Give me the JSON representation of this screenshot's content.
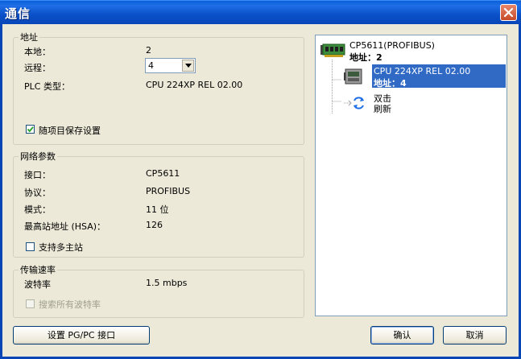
{
  "window": {
    "title": "通信"
  },
  "address": {
    "legend": "地址",
    "local_label": "本地：",
    "local_value": "2",
    "remote_label": "远程：",
    "remote_value": "4",
    "plc_type_label": "PLC 类型：",
    "plc_type_value": "CPU 224XP REL 02.00",
    "save_with_project_label": "随项目保存设置",
    "save_with_project_checked": true
  },
  "network": {
    "legend": "网络参数",
    "interface_label": "接口：",
    "interface_value": "CP5611",
    "protocol_label": "协议：",
    "protocol_value": "PROFIBUS",
    "mode_label": "模式：",
    "mode_value": "11 位",
    "hsa_label": "最高站地址 (HSA)：",
    "hsa_value": "126",
    "multimaster_label": "支持多主站",
    "multimaster_checked": false
  },
  "baud": {
    "legend": "传输速率",
    "rate_label": "波特率",
    "rate_value": "1.5 mbps",
    "search_all_label": "搜索所有波特率",
    "search_all_checked": false
  },
  "tree": {
    "root_name": "CP5611(PROFIBUS)",
    "root_addr": "地址：2",
    "device_name": "CPU 224XP REL 02.00",
    "device_addr": "地址：4",
    "refresh_line1": "双击",
    "refresh_line2": "刷新"
  },
  "buttons": {
    "set_pgpc": "设置 PG/PC 接口",
    "ok": "确认",
    "cancel": "取消"
  },
  "colors": {
    "title_bar": "#0a50c8",
    "selection": "#316ac5",
    "close": "#c64b2a"
  }
}
